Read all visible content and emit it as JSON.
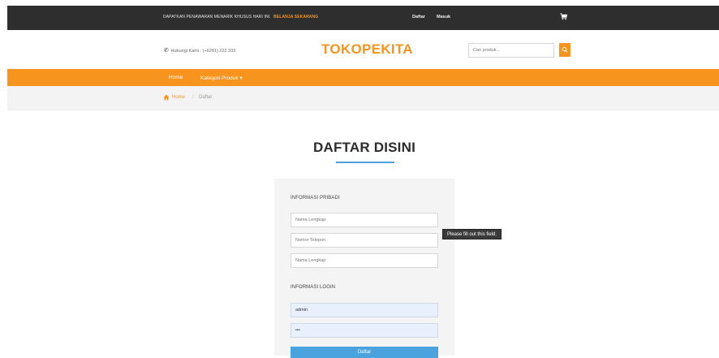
{
  "topbar": {
    "promo_text": "DAPATKAN PENAWARAN MENARIK KHUSUS HARI INI.",
    "promo_cta": "BELANJA SEKARANG",
    "register_link": "Daftar",
    "login_link": "Masuk",
    "cart_icon": "shopping-cart-icon"
  },
  "header": {
    "phone_label": "Hubungi Kami : (+6281) 222.333",
    "phone_icon": "phone-icon",
    "logo": "TOKOPEKITA",
    "search": {
      "placeholder": "Cari produk...",
      "icon": "search-icon"
    }
  },
  "nav": {
    "items": [
      {
        "label": "Home"
      },
      {
        "label": "Kategori Produk ▾"
      }
    ]
  },
  "breadcrumb": {
    "icon": "home-icon",
    "home": "Home",
    "separator": "/",
    "current": "Daftar"
  },
  "page": {
    "title": "DAFTAR DISINI"
  },
  "form": {
    "section_personal": "INFORMASI PRIBADI",
    "name": {
      "placeholder": "Nama Lengkap",
      "value": ""
    },
    "phone": {
      "placeholder": "Nomor Telepon",
      "value": ""
    },
    "address": {
      "placeholder": "Nama Lengkap",
      "value": ""
    },
    "section_login": "INFORMASI LOGIN",
    "username": {
      "value": "admin"
    },
    "password": {
      "value": "•••"
    },
    "submit_label": "Daftar"
  },
  "tooltip": {
    "text": "Please fill out this field."
  },
  "colors": {
    "accent": "#f7941d",
    "topbar": "#2e2e2e",
    "blue": "#4aa3df"
  }
}
